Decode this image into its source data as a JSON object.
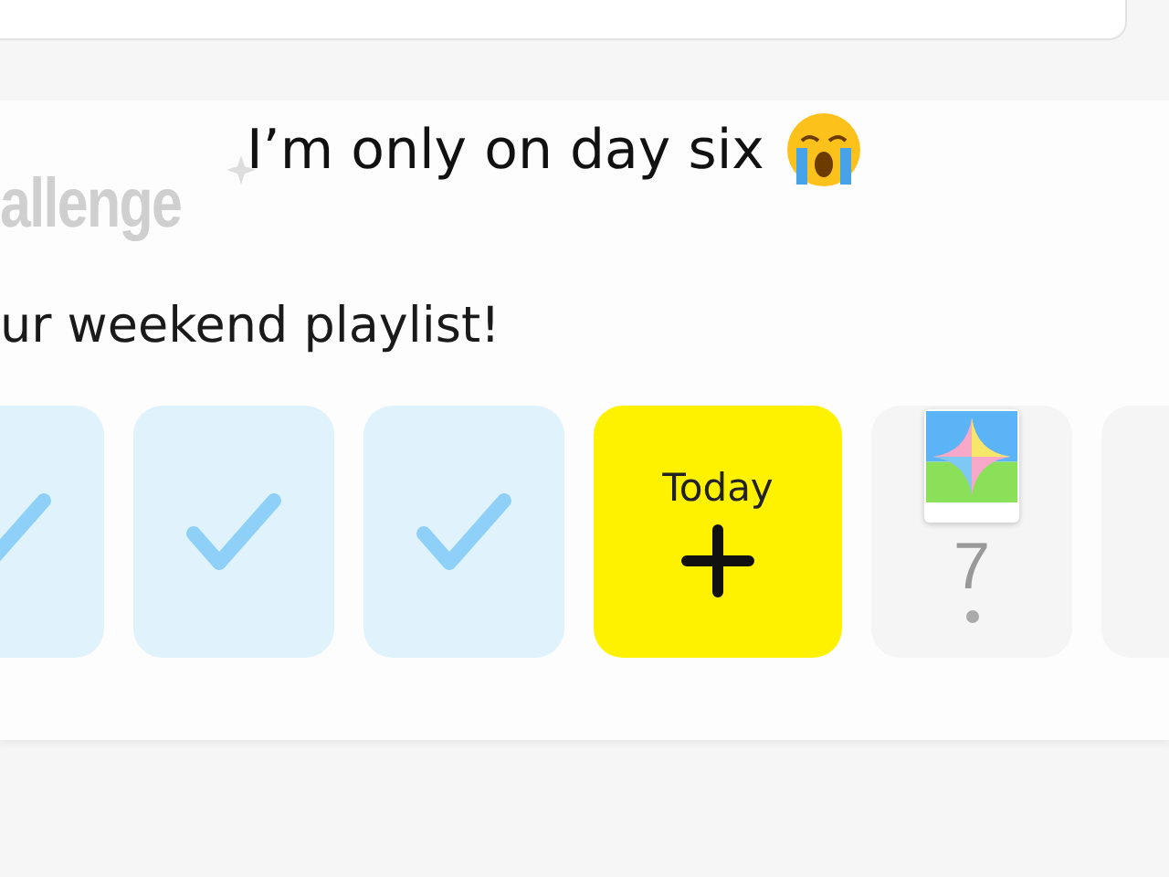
{
  "caption": {
    "text": "I’m only on day six"
  },
  "challenge": {
    "logo_text": "allenge",
    "description": "ur weekend playlist!"
  },
  "days": [
    {
      "kind": "done"
    },
    {
      "kind": "done"
    },
    {
      "kind": "done"
    },
    {
      "kind": "today",
      "label": "Today"
    },
    {
      "kind": "future",
      "number": "7",
      "sticker": true
    },
    {
      "kind": "future"
    }
  ]
}
